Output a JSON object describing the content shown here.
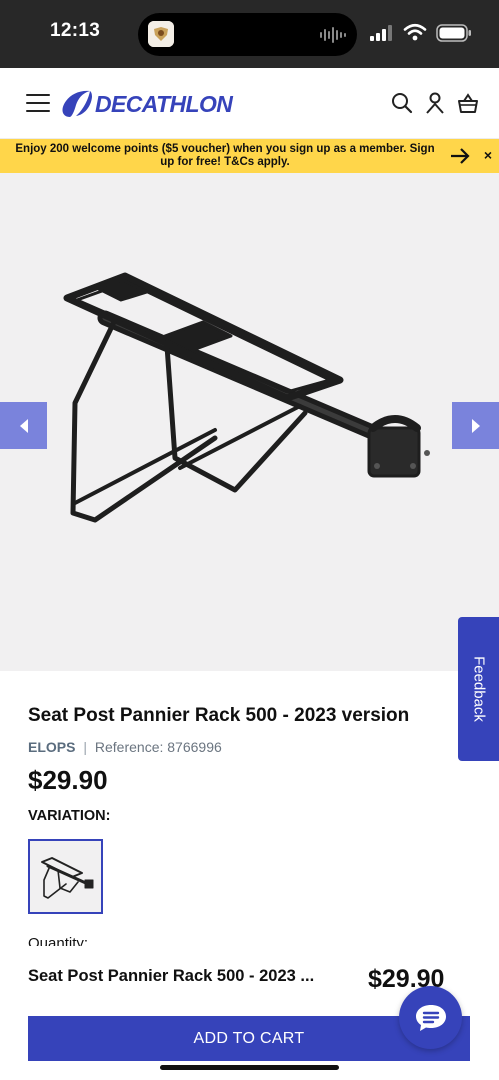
{
  "status_bar": {
    "time": "12:13"
  },
  "header": {
    "logo_text": "DECATHLON",
    "icons": [
      "menu-icon",
      "search-icon",
      "account-icon",
      "basket-icon"
    ]
  },
  "promo": {
    "text": "Enjoy 200 welcome points ($5 voucher) when you sign up as a member. Sign up for free! T&Cs apply.",
    "close_glyph": "×"
  },
  "gallery": {
    "feedback_label": "Feedback"
  },
  "product": {
    "title": "Seat Post Pannier Rack 500 - 2023 version",
    "brand": "ELOPS",
    "separator": "|",
    "reference": "Reference: 8766996",
    "price": "$29.90",
    "variation_label": "VARIATION:",
    "quantity_label": "Quantity:"
  },
  "sticky": {
    "title": "Seat Post Pannier Rack 500 - 2023 ...",
    "price": "$29.90",
    "add_to_cart": "ADD TO CART"
  },
  "colors": {
    "brand": "#3643ba",
    "promo": "#ffd64a",
    "gallery_bg": "#f1f0f1",
    "arrow_bg": "#7a83dc"
  }
}
